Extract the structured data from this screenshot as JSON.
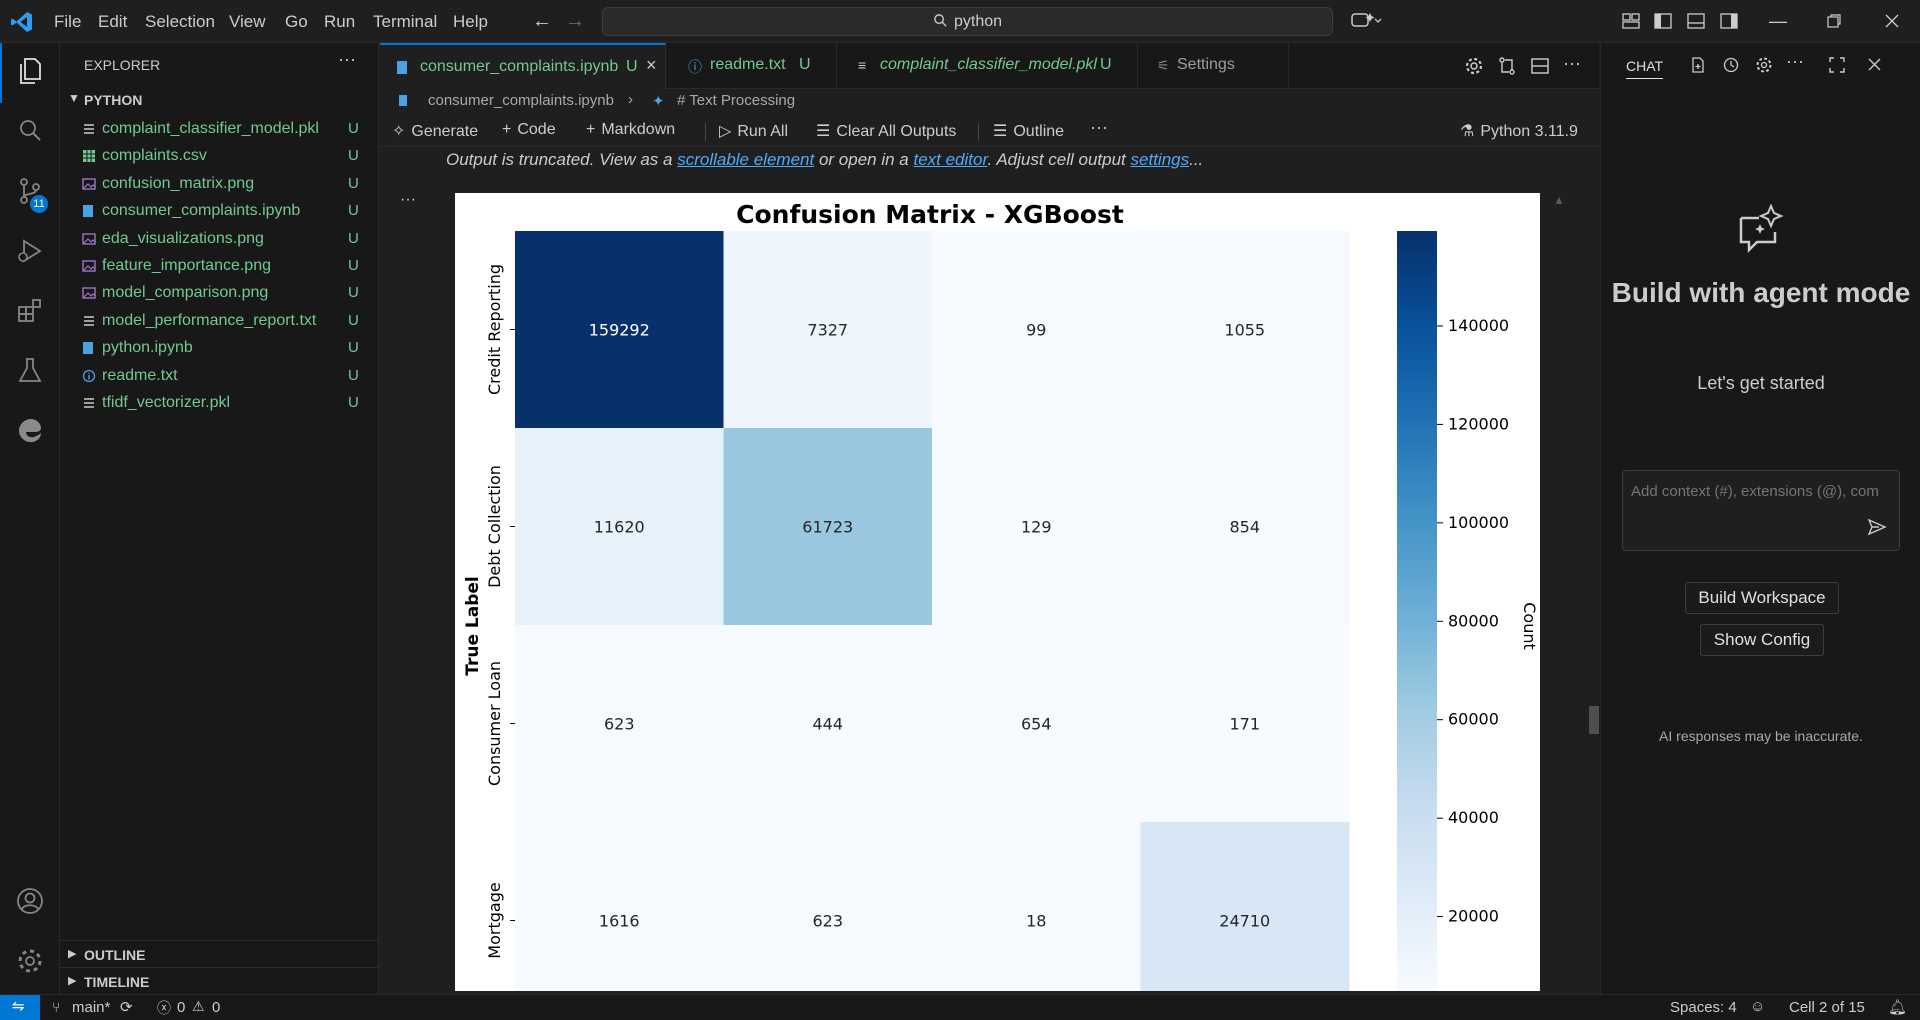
{
  "menu": [
    "File",
    "Edit",
    "Selection",
    "View",
    "Go",
    "Run",
    "Terminal",
    "Help"
  ],
  "search": {
    "value": "python"
  },
  "sidebar": {
    "title": "EXPLORER",
    "folder": "PYTHON",
    "files": [
      {
        "name": "complaint_classifier_model.pkl",
        "status": "U",
        "icon": "lines-icon"
      },
      {
        "name": "complaints.csv",
        "status": "U",
        "icon": "table-icon"
      },
      {
        "name": "confusion_matrix.png",
        "status": "U",
        "icon": "image-icon"
      },
      {
        "name": "consumer_complaints.ipynb",
        "status": "U",
        "icon": "notebook-icon"
      },
      {
        "name": "eda_visualizations.png",
        "status": "U",
        "icon": "image-icon"
      },
      {
        "name": "feature_importance.png",
        "status": "U",
        "icon": "image-icon"
      },
      {
        "name": "model_comparison.png",
        "status": "U",
        "icon": "image-icon"
      },
      {
        "name": "model_performance_report.txt",
        "status": "U",
        "icon": "lines-icon"
      },
      {
        "name": "python.ipynb",
        "status": "U",
        "icon": "notebook-icon"
      },
      {
        "name": "readme.txt",
        "status": "U",
        "icon": "info-icon"
      },
      {
        "name": "tfidf_vectorizer.pkl",
        "status": "U",
        "icon": "lines-icon"
      }
    ],
    "outline": "OUTLINE",
    "timeline": "TIMELINE"
  },
  "activity": {
    "scm_badge": "11"
  },
  "tabs": [
    {
      "label": "consumer_complaints.ipynb",
      "status": "U"
    },
    {
      "label": "readme.txt",
      "status": "U"
    },
    {
      "label": "complaint_classifier_model.pkl",
      "status": "U"
    },
    {
      "label": "Settings",
      "status": ""
    }
  ],
  "breadcrumb": {
    "file": "consumer_complaints.ipynb",
    "section": "# Text Processing"
  },
  "toolbar": {
    "generate": "Generate",
    "code": "Code",
    "markdown": "Markdown",
    "run_all": "Run All",
    "clear_outputs": "Clear All Outputs",
    "outline": "Outline",
    "kernel": "Python 3.11.9"
  },
  "truncated": {
    "p1": "Output is truncated. View as a ",
    "link1": "scrollable element",
    "p2": " or open in a ",
    "link2": "text editor",
    "p3": ". Adjust cell output ",
    "link3": "settings",
    "p4": "..."
  },
  "chart_data": {
    "type": "heatmap",
    "title": "Confusion Matrix - XGBoost",
    "ylabel": "True Label",
    "colorbar_label": "Count",
    "row_labels": [
      "Credit Reporting",
      "Debt Collection",
      "Consumer Loan",
      "Mortgage"
    ],
    "values": [
      [
        159292,
        7327,
        99,
        1055
      ],
      [
        11620,
        61723,
        129,
        854
      ],
      [
        623,
        444,
        654,
        171
      ],
      [
        1616,
        623,
        18,
        24710
      ]
    ],
    "colorbar_ticks": [
      "140000",
      "120000",
      "100000",
      "80000",
      "60000",
      "40000",
      "20000"
    ],
    "colorbar_tick_values": [
      140000,
      120000,
      100000,
      80000,
      60000,
      40000,
      20000
    ],
    "vmin": 0,
    "vmax": 159292,
    "colormap": "Blues"
  },
  "chat": {
    "title": "CHAT",
    "heading": "Build with agent mode",
    "subtitle": "Let's get started",
    "input_placeholder": "Add context (#), extensions (@), com",
    "btn1": "Build Workspace",
    "btn2": "Show Config",
    "disclaimer": "AI responses may be inaccurate."
  },
  "status": {
    "branch": "main*",
    "errors": "0",
    "warnings": "0",
    "spaces": "Spaces: 4",
    "cell": "Cell 2 of 15"
  },
  "colors": {
    "accent": "#0078d4",
    "git_untracked": "#73c991",
    "link": "#4daafc"
  }
}
